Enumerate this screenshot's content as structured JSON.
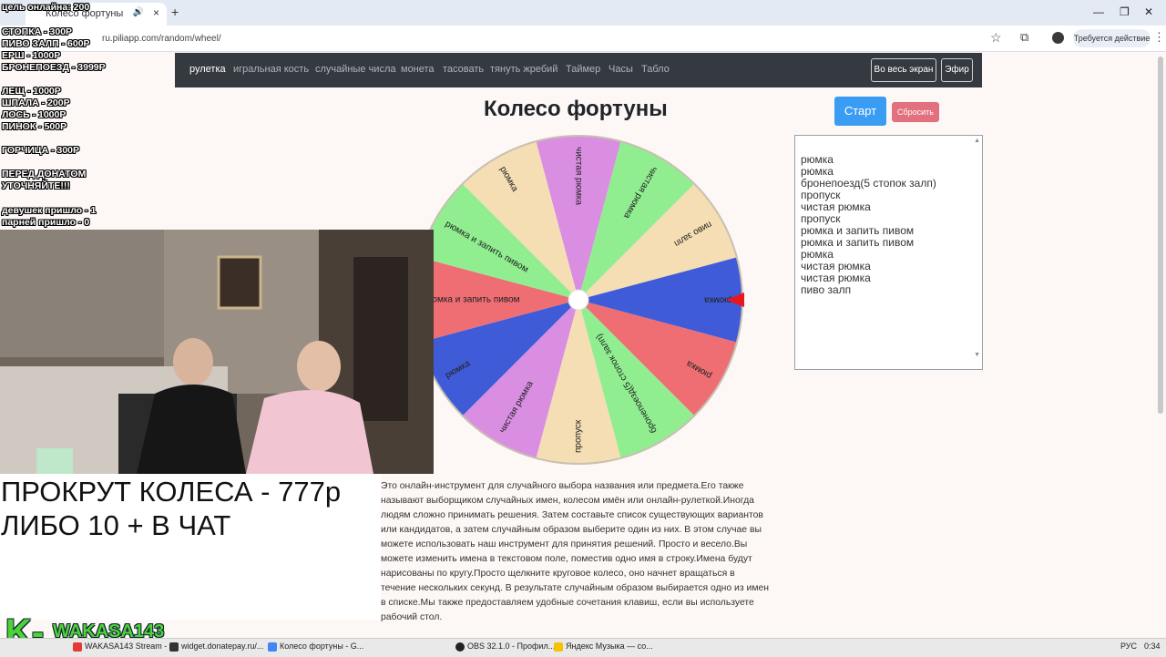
{
  "browser": {
    "tab_title": "Колесо фортуны",
    "url": "ru.piliapp.com/random/wheel/",
    "action_chip": "Требуется действие",
    "new_tab": "+",
    "tab_close": "×"
  },
  "nav": {
    "items": [
      "рулетка",
      "игральная кость",
      "случайные числа",
      "монета",
      "тасовать",
      "тянуть жребий",
      "Таймер",
      "Часы",
      "Табло"
    ],
    "fullscreen": "Во весь экран",
    "live": "Эфир"
  },
  "wheel": {
    "title": "Колесо фортуны",
    "start": "Старт",
    "reset": "Сбросить",
    "segments": [
      {
        "label": "чистая рюмка",
        "color": "#d98ee2"
      },
      {
        "label": "чистая рюмка",
        "color": "#90ee90"
      },
      {
        "label": "пиво залп",
        "color": "#f5deb3"
      },
      {
        "label": "рюмка",
        "color": "#3f5bd8"
      },
      {
        "label": "рюмка",
        "color": "#ee6e73"
      },
      {
        "label": "бронепоезд(5 стопок залп)",
        "color": "#90ee90"
      },
      {
        "label": "пропуск",
        "color": "#f5deb3"
      },
      {
        "label": "чистая рюмка",
        "color": "#d98ee2"
      },
      {
        "label": "рюмка",
        "color": "#3f5bd8"
      },
      {
        "label": "рюмка и запить пивом",
        "color": "#ee6e73"
      },
      {
        "label": "рюмка и запить пивом",
        "color": "#90ee90"
      },
      {
        "label": "рюмка",
        "color": "#f5deb3"
      }
    ]
  },
  "names_list": [
    "рюмка",
    "рюмка",
    "бронепоезд(5 стопок залп)",
    "пропуск",
    "чистая рюмка",
    "пропуск",
    "рюмка и запить пивом",
    "рюмка и запить пивом",
    "рюмка",
    "чистая рюмка",
    "чистая рюмка",
    "пиво залп"
  ],
  "description": "Это онлайн-инструмент для случайного выбора названия или предмета.Его также называют выборщиком случайных имен, колесом имён или онлайн-рулеткой.Иногда людям сложно принимать решения. Затем составьте список существующих вариантов или кандидатов, а затем случайным образом выберите один из них. В этом случае вы можете использовать наш инструмент для принятия решений. Просто и весело.Вы можете изменить имена в текстовом поле, поместив одно имя в строку.Имена будут нарисованы по кругу.Просто щелкните круговое колесо, оно начнет вращаться в течение нескольких секунд. В результате случайным образом выбирается одно из имен в списке.Мы также предоставляем удобные сочетания клавиш, если вы используете рабочий стол.",
  "overlay": {
    "lines": [
      "цель онлайна: 200",
      "СТОПКА - 300Р",
      "ПИВО ЗАЛП - 600Р",
      "ЕРШ - 1000Р",
      "БРОНЕПОЕЗД - 3999Р",
      "ЛЕЩ - 1000Р",
      "ШПАЛА - 200Р",
      "ЛОСЬ - 1000Р",
      "ПИНОК - 500Р",
      "ГОРЧИЦА - 300Р",
      "ПЕРЕД  ДОНАТОМ",
      "УТОЧНЯЙТЕ!!!",
      "девушек пришло - 1",
      "парней пришло - 0"
    ],
    "promo_1": "ПРОКРУТ КОЛЕСА - 777р",
    "promo_2": "ЛИБО 10 + В ЧАТ",
    "brand_k": "K-",
    "brand_name": "WAKASA143"
  },
  "taskbar": {
    "tasks": [
      "WAKASA143 Stream - ...",
      "widget.donatepay.ru/...",
      "Колесо фортуны - G...",
      "OBS 32.1.0 - Профил...",
      "Яндекс Музыка — со..."
    ],
    "lang": "РУС",
    "time": "0:34"
  },
  "colors": {
    "navbar": "#343a40",
    "start": "#3a9cf2",
    "reset": "#e2707f",
    "pointer": "#e8171c"
  }
}
